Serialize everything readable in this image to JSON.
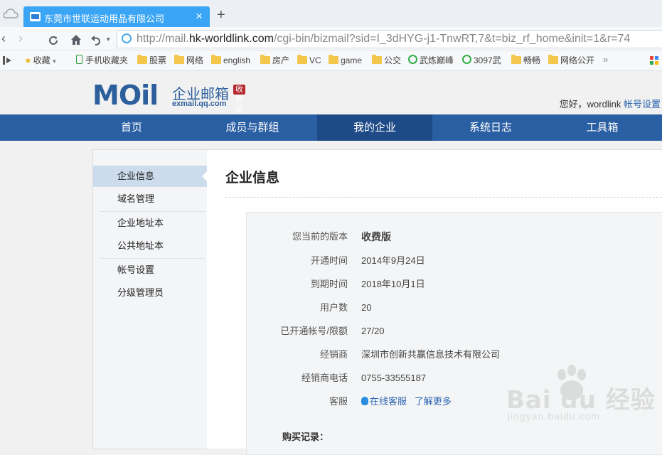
{
  "browser": {
    "tab_title": "东莞市世联运动用品有限公司",
    "tab_close": "×",
    "new_tab": "+",
    "url_prefix": "http://mail.",
    "url_host": "hk-worldlink.com",
    "url_rest": "/cgi-bin/bizmail?sid=I_3dHYG-j1-TnwRT,7&t=biz_rf_home&init=1&r=74",
    "bookmarks": [
      "收藏",
      "手机收藏夹",
      "股票",
      "网络",
      "english",
      "房产",
      "VC",
      "game",
      "公交",
      "武炼巅峰",
      "3097武",
      "畅畅",
      "网络公开"
    ]
  },
  "header": {
    "logo_mail": "MOil",
    "logo_cn": "企业邮箱",
    "logo_badge": "收费版",
    "logo_sub": "exmail.qq.com",
    "greeting": "您好，wordlink",
    "account_link": "帐号设置"
  },
  "main_nav": [
    "首页",
    "成员与群组",
    "我的企业",
    "系统日志",
    "工具箱"
  ],
  "sidebar": {
    "items": [
      "企业信息",
      "域名管理",
      "企业地址本",
      "公共地址本",
      "帐号设置",
      "分级管理员"
    ]
  },
  "content": {
    "title": "企业信息",
    "rows": [
      {
        "label": "您当前的版本",
        "value": "收费版"
      },
      {
        "label": "开通时间",
        "value": "2014年9月24日"
      },
      {
        "label": "到期时间",
        "value": "2018年10月1日"
      },
      {
        "label": "用户数",
        "value": "20"
      },
      {
        "label": "已开通帐号/限额",
        "value": "27/20"
      },
      {
        "label": "经销商",
        "value": "深圳市创新共赢信息技术有限公司"
      },
      {
        "label": "经销商电话",
        "value": "0755-33555187"
      }
    ],
    "service_label": "客服",
    "online_service": "在线客服",
    "learn_more": "了解更多",
    "purchase_records": "购买记录："
  },
  "watermark": {
    "big": "Bai du 经验",
    "small": "jingyan.baidu.com"
  },
  "colors": {
    "nav_bg": "#2a5fa4",
    "nav_active": "#1e4b88",
    "tab_bg": "#3aa4f5",
    "link": "#2962b0"
  }
}
